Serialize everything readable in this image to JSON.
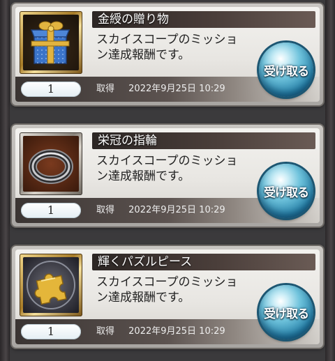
{
  "items": [
    {
      "name": "金綬の贈り物",
      "description_line1": "スカイスコープのミッショ",
      "description_line2": "ン達成報酬です。",
      "quantity": "1",
      "acquired_label": "取得",
      "acquired_date": "2022年9月25日 10:29",
      "receive_label": "受け取る",
      "icon": "gift-box-icon"
    },
    {
      "name": "栄冠の指輪",
      "description_line1": "スカイスコープのミッショ",
      "description_line2": "ン達成報酬です。",
      "quantity": "1",
      "acquired_label": "取得",
      "acquired_date": "2022年9月25日 10:29",
      "receive_label": "受け取る",
      "icon": "ring-icon"
    },
    {
      "name": "輝くパズルピース",
      "description_line1": "スカイスコープのミッショ",
      "description_line2": "ン達成報酬です。",
      "quantity": "1",
      "acquired_label": "取得",
      "acquired_date": "2022年9月25日 10:29",
      "receive_label": "受け取る",
      "icon": "puzzle-piece-icon"
    }
  ],
  "colors": {
    "title_bar": "#2c2624",
    "button_blue": "#2b86ad",
    "card_bg": "#f3f2ef"
  }
}
